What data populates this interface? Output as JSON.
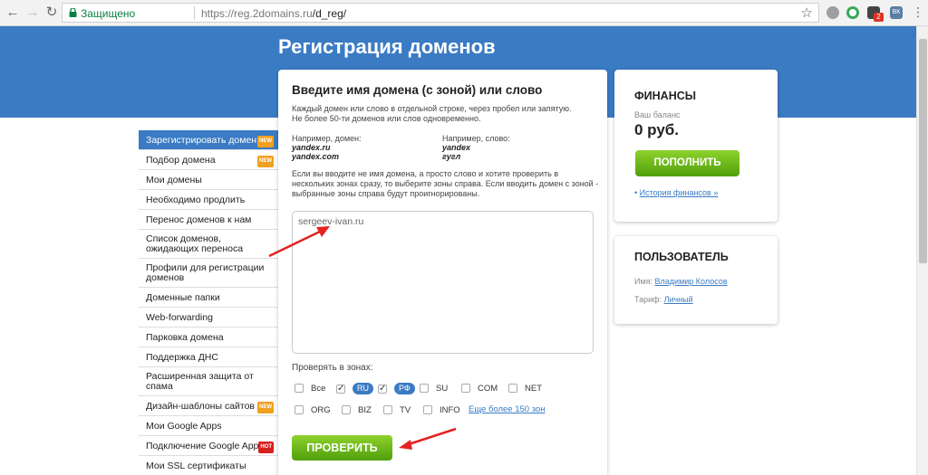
{
  "browser": {
    "secure_label": "Защищено",
    "url_host": "https://reg.2domains.ru",
    "url_path": "/d_reg/",
    "ext_badge": "2",
    "ext_vk_label": "ВК"
  },
  "page": {
    "title": "Регистрация доменов"
  },
  "sidebar": {
    "items": [
      {
        "label": "Зарегистрировать домен",
        "tag": "NEW"
      },
      {
        "label": "Подбор домена",
        "tag": "NEW"
      },
      {
        "label": "Мои домены"
      },
      {
        "label": "Необходимо продлить"
      },
      {
        "label": "Перенос доменов к нам"
      },
      {
        "label": "Список доменов, ожидающих переноса"
      },
      {
        "label": "Профили для регистрации доменов"
      },
      {
        "label": "Доменные папки"
      },
      {
        "label": "Web-forwarding"
      },
      {
        "label": "Парковка домена"
      },
      {
        "label": "Поддержка ДНС"
      },
      {
        "label": "Расширенная защита от спама"
      },
      {
        "label": "Дизайн-шаблоны сайтов",
        "tag": "NEW"
      },
      {
        "label": "Мои Google Apps"
      },
      {
        "label": "Подключение Google Apps",
        "tag": "HOT"
      },
      {
        "label": "Мои SSL сертификаты"
      }
    ]
  },
  "main": {
    "heading": "Введите имя домена (с зоной) или слово",
    "hint_line1": "Каждый домен или слово в отдельной строке, через пробел или запятую.",
    "hint_line2": "Не более 50-ти доменов или слов одновременно.",
    "example_domain_label": "Например, домен:",
    "example_domain_1": "yandex.ru",
    "example_domain_2": "yandex.com",
    "example_word_label": "Например, слово:",
    "example_word_1": "yandex",
    "example_word_2": "гугл",
    "hint2": "Если вы вводите не имя домена, а просто слово и хотите проверить в нескольких зонах сразу, то выберите зоны справа. Если вводить домен с зоной - выбранные зоны справа будут проигнорированы.",
    "input_value": "sergeev-ivan.ru",
    "zones_label": "Проверять в зонах:",
    "zones": [
      {
        "label": "Все",
        "checked": false
      },
      {
        "label": "RU",
        "checked": true
      },
      {
        "label": "РФ",
        "checked": true
      },
      {
        "label": "SU",
        "checked": false
      },
      {
        "label": "COM",
        "checked": false
      },
      {
        "label": "NET",
        "checked": false
      },
      {
        "label": "ORG",
        "checked": false
      },
      {
        "label": "BIZ",
        "checked": false
      },
      {
        "label": "TV",
        "checked": false
      },
      {
        "label": "INFO",
        "checked": false
      }
    ],
    "more_zones": "Еще более 150 зон",
    "check_button": "ПРОВЕРИТЬ"
  },
  "finance": {
    "heading": "ФИНАНСЫ",
    "balance_label": "Ваш баланс",
    "balance_value": "0 руб.",
    "topup_button": "ПОПОЛНИТЬ",
    "history_link": "История финансов »"
  },
  "user": {
    "heading": "ПОЛЬЗОВАТЕЛЬ",
    "name_label": "Имя:",
    "name_value": "Владимир Колосов",
    "tariff_label": "Тариф:",
    "tariff_value": "Личный"
  },
  "colors": {
    "brand_blue": "#3a7bc4",
    "button_green": "#6ab81a",
    "arrow_red": "#e32222"
  }
}
